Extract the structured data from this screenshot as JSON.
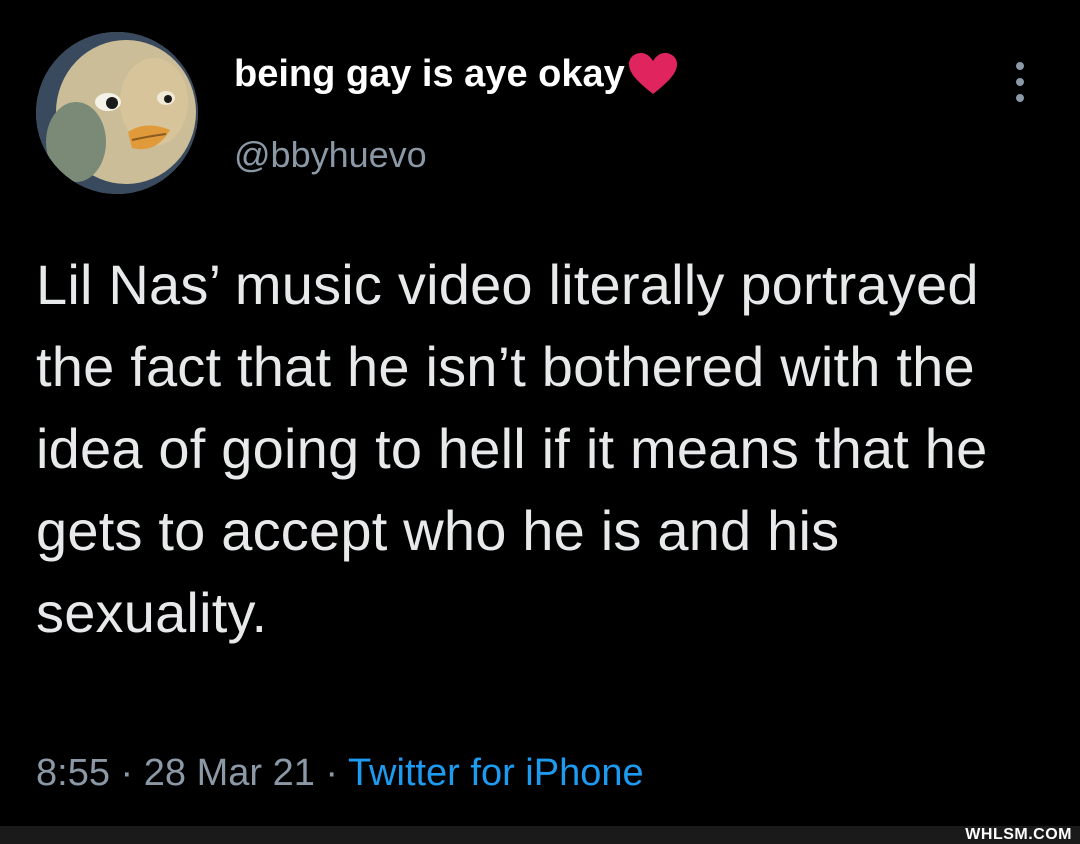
{
  "tweet": {
    "display_name": "being gay is aye okay",
    "display_name_emoji": "red-heart-icon",
    "handle": "@bbyhuevo",
    "text": "Lil Nas’ music video literally portrayed the fact that he isn’t bothered with the idea of going to hell if it means that he gets to accept who he is and his sexuality.",
    "time": "8:55",
    "separator": "·",
    "date": "28 Mar 21",
    "source": "Twitter for iPhone"
  },
  "watermark": "WHLSM.COM",
  "colors": {
    "background": "#000000",
    "text": "#e7e9ea",
    "muted": "#8b98a5",
    "link": "#1d9bf0",
    "heart": "#e0245e"
  }
}
